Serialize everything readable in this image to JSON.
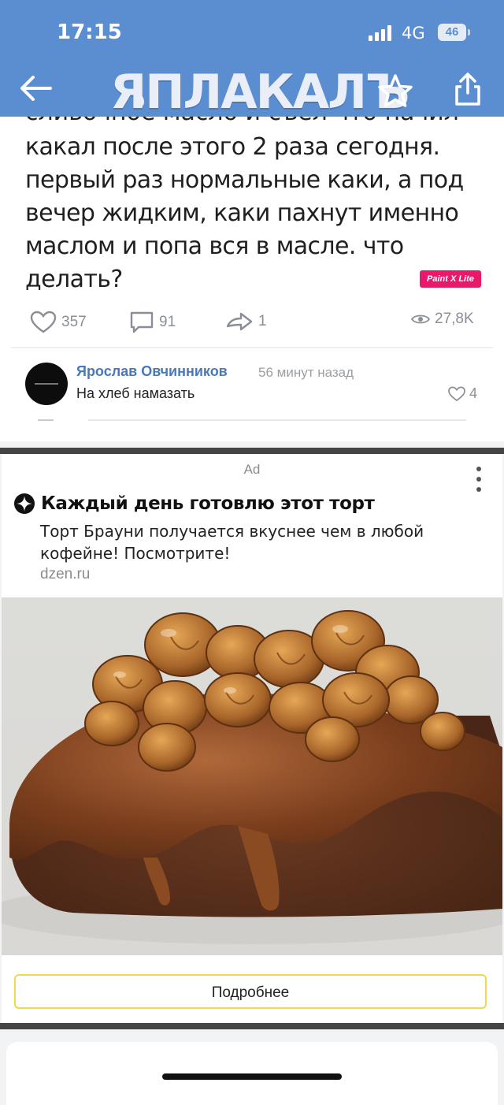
{
  "status_bar": {
    "time": "17:15",
    "network": "4G",
    "battery": "46"
  },
  "header": {
    "logo": "ЯПЛАКАЛЪ",
    "back_icon": "arrow-left-icon",
    "favorite_icon": "star-icon",
    "share_icon": "share-icon"
  },
  "post": {
    "partial_line": "сливочное масло и съел что начил",
    "text": "какал после этого 2 раза сегодня. первый раз нормальные каки, а под вечер жидким, каки пахнут именно маслом и попа вся в масле. что делать?",
    "watermark": "Paint X Lite",
    "likes": "357",
    "comments": "91",
    "reposts": "1",
    "views": "27,8K"
  },
  "comment": {
    "author": "Ярослав Овчинников",
    "time": "56 минут назад",
    "text": "На хлеб намазать",
    "likes": "4"
  },
  "ad": {
    "label": "Ad",
    "title": "Каждый день готовлю этот торт",
    "description": "Торт Брауни получается вкуснее чем в любой кофейне! Посмотрите!",
    "domain": "dzen.ru",
    "button": "Подробнее",
    "image_subject": "brownie-cake-with-walnuts-and-caramel"
  },
  "colors": {
    "header": "#5b8ed1",
    "badge": "#e8186b",
    "author": "#4a78b8",
    "button_border": "#f2d84c"
  }
}
